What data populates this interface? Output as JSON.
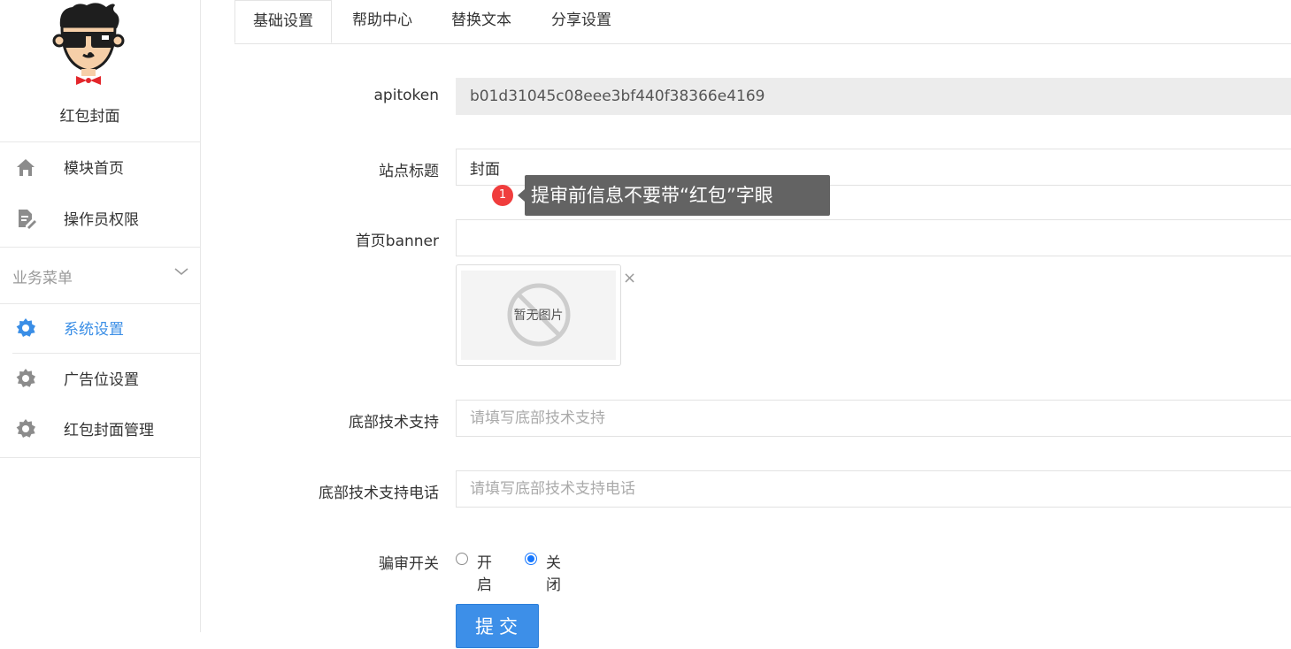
{
  "sidebar": {
    "title": "红包封面",
    "main_items": [
      {
        "label": "模块首页",
        "icon": "home-icon"
      },
      {
        "label": "操作员权限",
        "icon": "document-edit-icon"
      }
    ],
    "section_title": "业务菜单",
    "section_items": [
      {
        "label": "系统设置",
        "icon": "gear-icon",
        "active": true
      },
      {
        "label": "广告位设置",
        "icon": "gear-icon"
      },
      {
        "label": "红包封面管理",
        "icon": "gear-icon"
      }
    ]
  },
  "tabs": [
    {
      "label": "基础设置",
      "active": true
    },
    {
      "label": "帮助中心"
    },
    {
      "label": "替换文本"
    },
    {
      "label": "分享设置"
    }
  ],
  "form": {
    "apitoken": {
      "label": "apitoken",
      "value": "b01d31045c08eee3bf440f38366e4169"
    },
    "site_title": {
      "label": "站点标题",
      "value": "封面"
    },
    "tooltip": {
      "badge": "1",
      "text": "提审前信息不要带“红包”字眼"
    },
    "banner": {
      "label": "首页banner",
      "value": "",
      "no_image_text": "暂无图片",
      "remove": "×"
    },
    "tech_support": {
      "label": "底部技术支持",
      "placeholder": "请填写底部技术支持"
    },
    "tech_phone": {
      "label": "底部技术支持电话",
      "placeholder": "请填写底部技术支持电话"
    },
    "review_switch": {
      "label": "骗审开关",
      "options": [
        "开启",
        "关闭"
      ],
      "selected": "关闭"
    },
    "submit": "提交"
  },
  "colors": {
    "accent": "#3a8ee6",
    "button": "#3d8fe8",
    "tooltip_bg": "#636363",
    "badge": "#f03d3d"
  }
}
